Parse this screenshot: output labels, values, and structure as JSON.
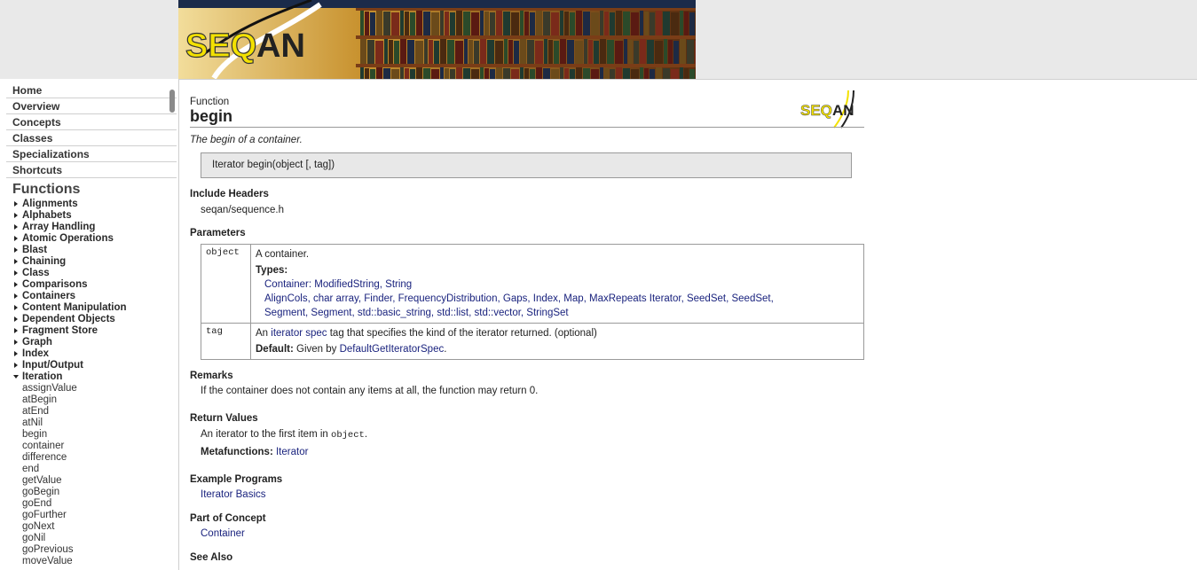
{
  "nav": {
    "links": [
      "Home",
      "Overview",
      "Concepts",
      "Classes",
      "Specializations",
      "Shortcuts"
    ],
    "section_title": "Functions",
    "categories": [
      "Alignments",
      "Alphabets",
      "Array Handling",
      "Atomic Operations",
      "Blast",
      "Chaining",
      "Class",
      "Comparisons",
      "Containers",
      "Content Manipulation",
      "Dependent Objects",
      "Fragment Store",
      "Graph",
      "Index",
      "Input/Output"
    ],
    "open_category": "Iteration",
    "open_items": [
      "assignValue",
      "atBegin",
      "atEnd",
      "atNil",
      "begin",
      "container",
      "difference",
      "end",
      "getValue",
      "goBegin",
      "goEnd",
      "goFurther",
      "goNext",
      "goNil",
      "goPrevious",
      "moveValue"
    ]
  },
  "logo": {
    "text_a": "SEQ",
    "text_b": "AN"
  },
  "page": {
    "kind": "Function",
    "name": "begin",
    "brief": "The begin of a container.",
    "signature": "Iterator begin(object [, tag])"
  },
  "include": {
    "title": "Include Headers",
    "value": "seqan/sequence.h"
  },
  "parameters": {
    "title": "Parameters",
    "object": {
      "name": "object",
      "desc": "A container.",
      "types_label": "Types:",
      "types_line1_prefix": "Container: ",
      "types_line1": "ModifiedString, String",
      "types_line2": "AlignCols, char array, Finder, FrequencyDistribution, Gaps, Index, Map, MaxRepeats Iterator, SeedSet, SeedSet,",
      "types_line3": "Segment, Segment, std::basic_string, std::list, std::vector, StringSet"
    },
    "tag": {
      "name": "tag",
      "desc_a": "An ",
      "desc_link": "iterator spec",
      "desc_b": " tag that specifies the kind of the iterator returned. (optional)",
      "default_label": "Default:",
      "default_a": " Given by ",
      "default_link": "DefaultGetIteratorSpec",
      "default_b": "."
    }
  },
  "remarks": {
    "title": "Remarks",
    "value": "If the container does not contain any items at all, the function may return 0."
  },
  "returns": {
    "title": "Return Values",
    "value_a": "An iterator to the first item in ",
    "value_code": "object",
    "value_b": ".",
    "meta_label": "Metafunctions:",
    "meta_link": "Iterator"
  },
  "examples": {
    "title": "Example Programs",
    "link": "Iterator Basics"
  },
  "concept": {
    "title": "Part of Concept",
    "link": "Container"
  },
  "see_also": {
    "title": "See Also"
  }
}
